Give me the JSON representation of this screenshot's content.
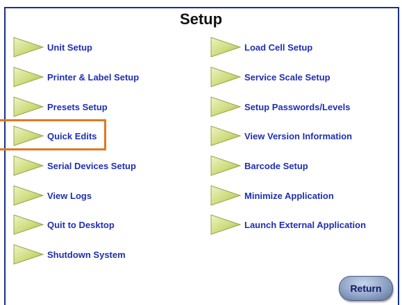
{
  "title": "Setup",
  "left_items": [
    {
      "label": "Unit Setup"
    },
    {
      "label": "Printer & Label Setup"
    },
    {
      "label": "Presets Setup"
    },
    {
      "label": "Quick Edits"
    },
    {
      "label": "Serial Devices Setup"
    },
    {
      "label": "View Logs"
    },
    {
      "label": "Quit to Desktop"
    },
    {
      "label": "Shutdown System"
    }
  ],
  "right_items": [
    {
      "label": "Load Cell Setup"
    },
    {
      "label": "Service Scale Setup"
    },
    {
      "label": "Setup Passwords/Levels"
    },
    {
      "label": "View Version Information"
    },
    {
      "label": "Barcode Setup"
    },
    {
      "label": "Minimize Application"
    },
    {
      "label": "Launch External Application"
    }
  ],
  "return_label": "Return",
  "colors": {
    "label": "#1f2fb2",
    "arrow_fill": "#d4e08a",
    "highlight": "#e07820",
    "frame": "#1b2f8a"
  },
  "icons": {
    "menu_item": "triangle-arrow-icon"
  }
}
